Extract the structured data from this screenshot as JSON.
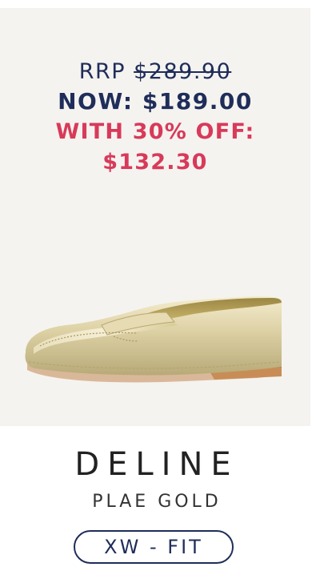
{
  "pricing": {
    "rrp_label": "RRP",
    "rrp_value": "$289.90",
    "now_text": "NOW: $189.00",
    "discount_text": "WITH 30% OFF: $132.30"
  },
  "product": {
    "name": "DELINE",
    "color": "PLAE GOLD",
    "fit": "XW - FIT",
    "image_icon": "gold-loafer-shoe"
  },
  "colors": {
    "navy": "#1f2d5a",
    "sale_red": "#d83a5a",
    "panel_bg": "#f5f3ef"
  }
}
